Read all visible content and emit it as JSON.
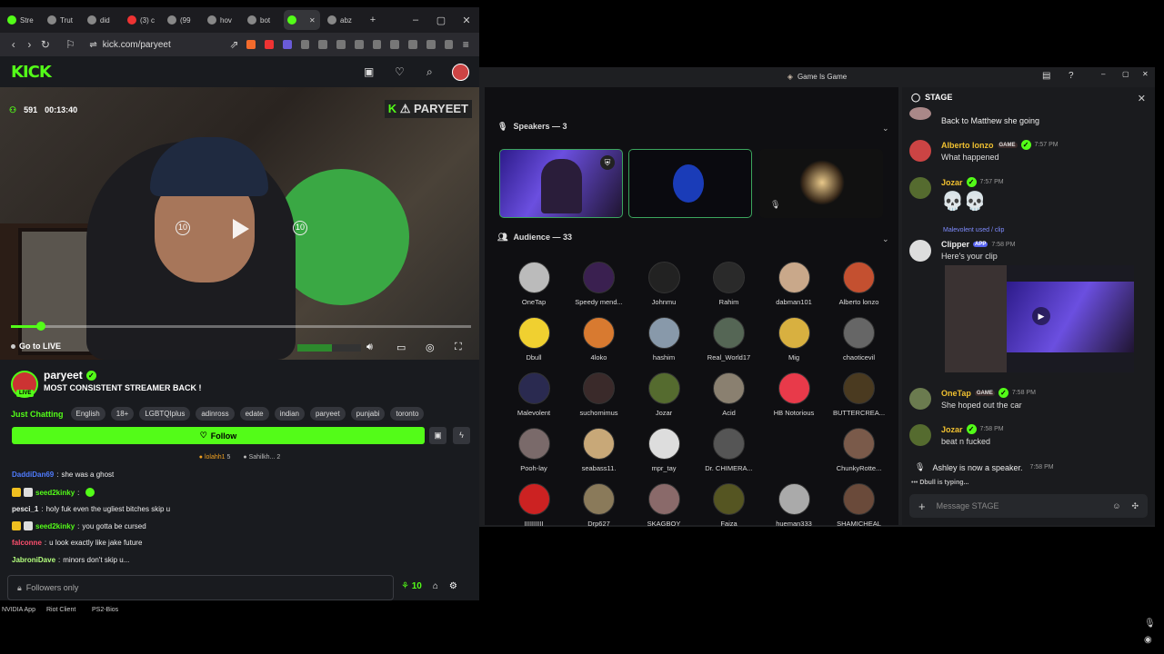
{
  "browser": {
    "tabs": [
      "Stre",
      "Trut",
      "did",
      "(3) c",
      "(99",
      "hov",
      "bot",
      "",
      "abz"
    ],
    "url": "kick.com/paryeet"
  },
  "kick": {
    "logo": "KICK",
    "viewer_count": "591",
    "uptime": "00:13:40",
    "overlay_name": "PARYEET",
    "go_live": "Go to LIVE",
    "progress_fraction": 0.065,
    "streamer": "paryeet",
    "live_badge": "LIVE",
    "stream_title": "MOST CONSISTENT STREAMER BACK !",
    "category": "Just Chatting",
    "tags": [
      "English",
      "18+",
      "LGBTQIplus",
      "adinross",
      "edate",
      "indian",
      "paryeet",
      "punjabi",
      "toronto"
    ],
    "follow_label": "Follow",
    "gifters": [
      {
        "name": "lolahh1",
        "count": "5"
      },
      {
        "name": "Sahilkh...",
        "count": "2"
      }
    ],
    "chat": [
      {
        "user": "DaddiDan69",
        "text": "she was a ghost",
        "color": "#4f7cff"
      },
      {
        "user": "seed2kinky",
        "text": "",
        "color": "#53fc18"
      },
      {
        "user": "pesci_1",
        "text": "holy fuk even the ugliest bitches skip u",
        "color": "#ffffff"
      },
      {
        "user": "seed2kinky",
        "text": "you gotta be cursed",
        "color": "#53fc18"
      },
      {
        "user": "falconne",
        "text": "u look exactly like jake future",
        "color": "#ff4f6e"
      },
      {
        "user": "JabroniDave",
        "text": "minors don't skip u...",
        "color": "#b3ff7d"
      }
    ],
    "chat_placeholder": "Followers only",
    "points": "10"
  },
  "desktop": [
    "NVIDIA App",
    "Riot Client",
    "PS2-Bios"
  ],
  "discord": {
    "window_title": "Game Is Game",
    "speakers_label": "Speakers — 3",
    "audience_label": "Audience — 33",
    "audience": [
      "OneTap",
      "Speedy mend...",
      "Johnmu",
      "Rahim",
      "dabman101",
      "Alberto lonzo",
      "Dbull",
      "4loko",
      "hashim",
      "Real_World17",
      "Mig",
      "chaoticevil",
      "Malevolent",
      "suchomimus",
      "Jozar",
      "Acid",
      "HB Notorious",
      "BUTTERCREA...",
      "Pooh-lay",
      "seabass11.",
      "mpr_tay",
      "Dr. CHIMERA...",
      "",
      "ChunkyRotte...",
      "IIIIIIIIII",
      "Drp627",
      "SKAGBOY",
      "Faiza",
      "hueman333",
      "SHAMICHEAL"
    ],
    "stage_title": "STAGE",
    "messages": [
      {
        "text": "Back to Matthew she going"
      },
      {
        "name": "Alberto lonzo",
        "badge": "GAME",
        "time": "7:57 PM",
        "text": "What happened",
        "color": "#f0c030"
      },
      {
        "name": "Jozar",
        "time": "7:57 PM",
        "text": "💀💀",
        "color": "#f0c030"
      },
      {
        "reply": "Malevolent used",
        "reply_cmd": "/ clip"
      },
      {
        "name": "Clipper",
        "badge": "APP",
        "time": "7:58 PM",
        "text": "Here's your clip",
        "color": "#ffffff"
      },
      {
        "name": "OneTap",
        "badge": "GAME",
        "time": "7:58 PM",
        "text": "She hoped out the car",
        "color": "#f0c030"
      },
      {
        "name": "Jozar",
        "time": "7:58 PM",
        "text": "beat n fucked",
        "color": "#f0c030"
      }
    ],
    "system_msg": "Ashley is now a speaker.",
    "system_time": "7:58 PM",
    "typing": "Dbull is typing...",
    "input_placeholder": "Message STAGE"
  }
}
